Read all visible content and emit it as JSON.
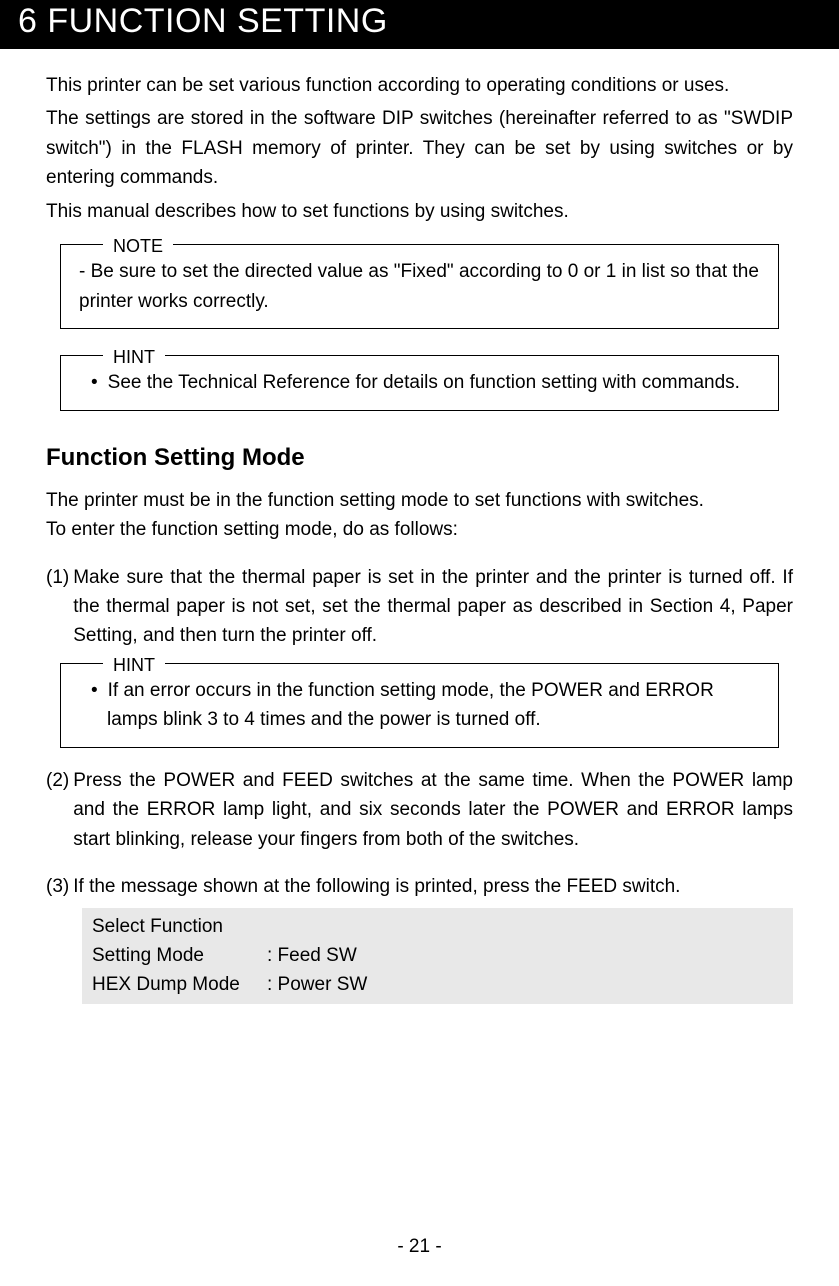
{
  "header": {
    "title": "6  FUNCTION SETTING"
  },
  "intro": {
    "p1": "This printer can be set various function according to operating conditions or uses.",
    "p2": "The settings are stored in the software DIP switches (hereinafter referred to as \"SWDIP switch\") in the FLASH memory of printer.  They can be set by using switches or by entering commands.",
    "p3": "This manual describes how to set functions by using switches."
  },
  "note": {
    "label": "NOTE",
    "text": "- Be sure to set the directed value as \"Fixed\" according to 0 or 1 in list so that the printer works correctly."
  },
  "hint1": {
    "label": "HINT",
    "bullet": "See the Technical Reference for details on function setting with commands."
  },
  "section": {
    "title": " Function Setting Mode",
    "intro_line1": "The printer must be in the function setting mode to set functions with switches.",
    "intro_line2": "To enter the function setting mode, do as follows:"
  },
  "steps": {
    "s1_num": "(1)",
    "s1_text": "Make sure that the thermal paper is set in the printer and the printer is turned off.  If the thermal paper is not set, set the thermal paper as described in Section 4, Paper Setting, and then turn the printer off.",
    "s1_hint_label": "HINT",
    "s1_hint_text": "If an error occurs in the function setting mode, the POWER and ERROR lamps blink 3 to 4 times and the power is turned off.",
    "s2_num": "(2)",
    "s2_text": "Press the POWER and FEED switches at the same time.  When the POWER lamp and the ERROR lamp light, and six seconds later the POWER and ERROR lamps start blinking, release your fingers from both of the switches.",
    "s3_num": "(3)",
    "s3_text": "If the message shown at the following is printed, press the FEED switch."
  },
  "printout": {
    "line1": "Select Function",
    "row1_col1": "Setting Mode",
    "row1_col2": ": Feed SW",
    "row2_col1": "HEX Dump Mode",
    "row2_col2": ": Power SW"
  },
  "page_number": "- 21 -"
}
